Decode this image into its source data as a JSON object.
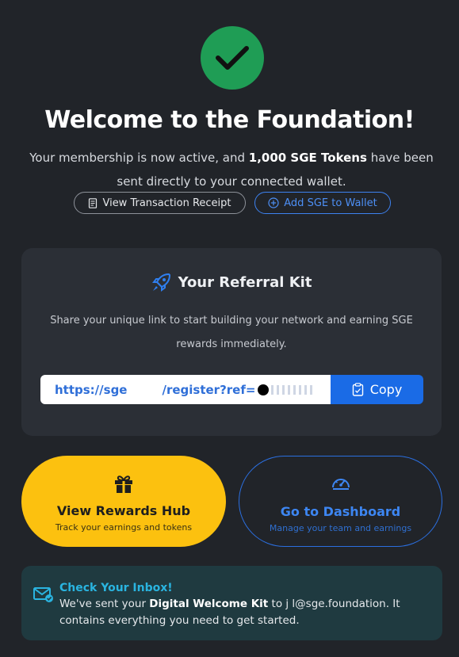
{
  "header": {
    "title": "Welcome to the Foundation!",
    "subtitle_pre": "Your membership is now active, and ",
    "subtitle_bold": "1,000 SGE Tokens",
    "subtitle_post": " have been sent directly to your connected wallet.",
    "receipt_label": "View Transaction Receipt",
    "wallet_label": "Add SGE to Wallet"
  },
  "referral": {
    "title": "Your Referral Kit",
    "description": "Share your unique link to start building your network and earning SGE rewards immediately.",
    "link_start": "https://sge",
    "link_mid": "/register?ref=",
    "copy_label": "Copy"
  },
  "actions": {
    "rewards_label": "View Rewards Hub",
    "rewards_sub": "Track your earnings and tokens",
    "dashboard_label": "Go to Dashboard",
    "dashboard_sub": "Manage your team and earnings"
  },
  "inbox": {
    "title": "Check Your Inbox!",
    "text_pre": "We've sent your ",
    "text_bold": "Digital Welcome Kit",
    "text_post": " to j      l@sge.foundation. It contains everything you need to get started."
  },
  "colors": {
    "background": "#212429",
    "success": "#1f9d55",
    "accent_blue": "#1a6be6",
    "accent_yellow": "#fcc10f",
    "inbox_bg": "#1f3a40"
  }
}
